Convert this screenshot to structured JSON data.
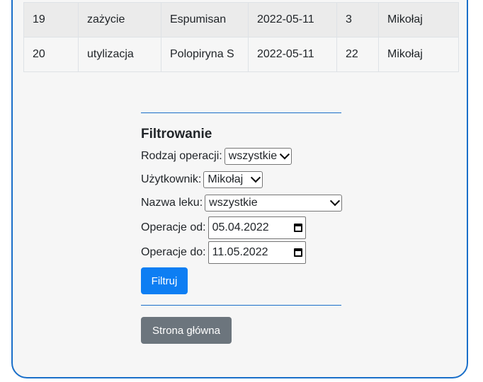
{
  "table": {
    "rows": [
      {
        "id": "19",
        "operation": "zażycie",
        "medicine": "Espumisan",
        "date": "2022-05-11",
        "quantity": "3",
        "user": "Mikołaj"
      },
      {
        "id": "20",
        "operation": "utylizacja",
        "medicine": "Polopiryna S",
        "date": "2022-05-11",
        "quantity": "22",
        "user": "Mikołaj"
      }
    ]
  },
  "filter": {
    "heading": "Filtrowanie",
    "operation_type": {
      "label": "Rodzaj operacji:",
      "value": "wszystkie"
    },
    "user": {
      "label": "Użytkownik:",
      "value": "Mikołaj"
    },
    "medicine_name": {
      "label": "Nazwa leku:",
      "value": "wszystkie"
    },
    "date_from": {
      "label": "Operacje od:",
      "value": "05.04.2022"
    },
    "date_to": {
      "label": "Operacje do:",
      "value": "11.05.2022"
    },
    "submit_label": "Filtruj"
  },
  "home_button_label": "Strona główna",
  "colors": {
    "accent": "#1a6fc9",
    "primary_button": "#0d7ef3",
    "secondary_button": "#6c757d"
  }
}
